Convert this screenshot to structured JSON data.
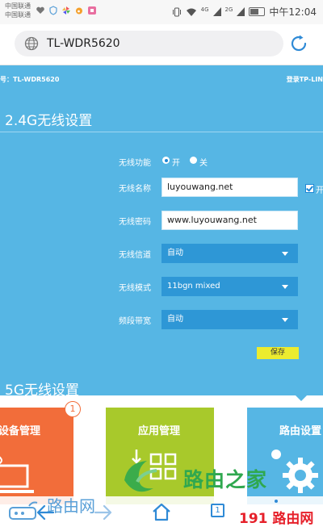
{
  "status_bar": {
    "carrier_1": "中国联通",
    "carrier_2": "中国联通",
    "signal_4g": "4G",
    "signal_2g": "2G",
    "time": "中午12:04"
  },
  "browser": {
    "url": "TL-WDR5620"
  },
  "router_page": {
    "model_label": "号：TL-WDR5620",
    "login_link": "登录TP-LIN",
    "section_24g_title": "2.4G无线设置",
    "wireless_function_label": "无线功能",
    "radio_on_label": "开",
    "radio_off_label": "关",
    "ssid_label": "无线名称",
    "ssid_value": "luyouwang.net",
    "hide_ssid_checkbox_label": "开",
    "password_label": "无线密码",
    "password_value": "www.luyouwang.net",
    "channel_label": "无线信道",
    "channel_value": "自动",
    "mode_label": "无线模式",
    "mode_value": "11bgn mixed",
    "bandwidth_label": "频段带宽",
    "bandwidth_value": "自动",
    "save_label": "保存",
    "section_5g_title": "5G无线设置"
  },
  "tiles": {
    "device_mgmt_label": "设备管理",
    "device_mgmt_badge": "1",
    "app_mgmt_label": "应用管理",
    "router_settings_label": "路由设置"
  },
  "watermarks": {
    "brand_text": "路由之家",
    "logo_text": "路由网",
    "site_prefix": "191",
    "site_suffix": "路由网"
  },
  "bottom_nav": {
    "tab_count": "1"
  },
  "colors": {
    "page_blue": "#56b6e4",
    "select_blue": "#2e97d6",
    "save_yellow": "#ecec2f",
    "tile_orange": "#f26d3a",
    "tile_green": "#a8c92b",
    "tile_blue": "#56b6e4",
    "watermark_green": "#2fa84f",
    "watermark_red": "#e6202a"
  }
}
